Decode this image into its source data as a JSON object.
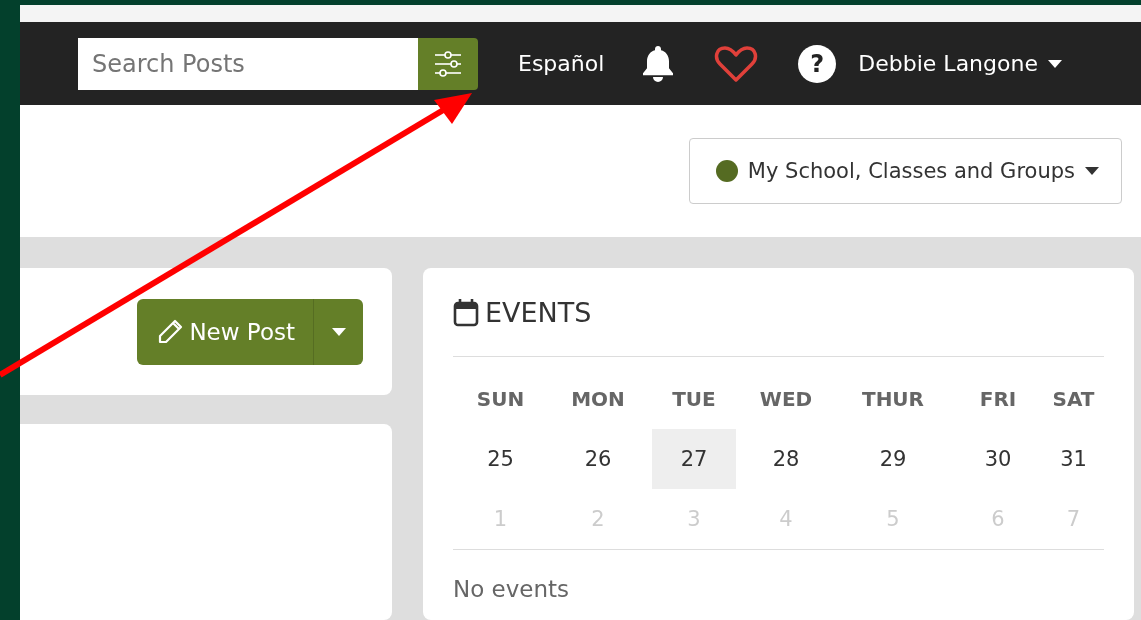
{
  "navbar": {
    "search": {
      "placeholder": "Search Posts"
    },
    "language_link": "Español",
    "user_menu": "Debbie Langone",
    "help_icon": "?"
  },
  "scope_dropdown": {
    "label": "My School, Classes and Groups",
    "color": "#556b22"
  },
  "new_post_button": {
    "label": "New Post"
  },
  "events": {
    "title": "EVENTS",
    "weekdays": [
      "SUN",
      "MON",
      "TUE",
      "WED",
      "THUR",
      "FRI",
      "SAT"
    ],
    "weeks": [
      [
        {
          "label": "25",
          "selected": false,
          "muted": false
        },
        {
          "label": "26",
          "selected": false,
          "muted": false
        },
        {
          "label": "27",
          "selected": true,
          "muted": false
        },
        {
          "label": "28",
          "selected": false,
          "muted": false
        },
        {
          "label": "29",
          "selected": false,
          "muted": false
        },
        {
          "label": "30",
          "selected": false,
          "muted": false
        },
        {
          "label": "31",
          "selected": false,
          "muted": false
        }
      ],
      [
        {
          "label": "1",
          "selected": false,
          "muted": true
        },
        {
          "label": "2",
          "selected": false,
          "muted": true
        },
        {
          "label": "3",
          "selected": false,
          "muted": true
        },
        {
          "label": "4",
          "selected": false,
          "muted": true
        },
        {
          "label": "5",
          "selected": false,
          "muted": true
        },
        {
          "label": "6",
          "selected": false,
          "muted": true
        },
        {
          "label": "7",
          "selected": false,
          "muted": true
        }
      ]
    ],
    "empty_message": "No events"
  }
}
